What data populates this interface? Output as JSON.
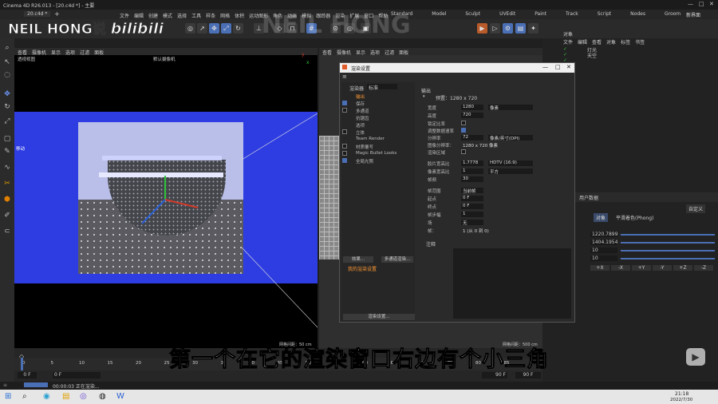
{
  "app": {
    "title": "Cinema 4D R26.013 - [20.c4d *] - 主要",
    "tab": "20.c4d *",
    "add_tab": "+"
  },
  "menu": [
    "文件",
    "编辑",
    "创建",
    "模式",
    "选择",
    "工具",
    "样条",
    "网格",
    "体积",
    "运动图形",
    "角色",
    "动画",
    "模拟",
    "跟踪器",
    "渲染",
    "扩展",
    "窗口",
    "帮助"
  ],
  "layouts": [
    "Standard",
    "Model",
    "Sculpt",
    "UVEdit",
    "Paint",
    "Track",
    "Script",
    "Nodes",
    "Groom"
  ],
  "new_layout": "新界面",
  "watermark": "NEIL HONG说",
  "brand_mark": "bilibili",
  "bg_watermark": "NEIL HONG",
  "viewport": {
    "menus": [
      "查看",
      "摄像机",
      "显示",
      "选项",
      "过滤",
      "面板"
    ],
    "name": "透视视图",
    "camera": "默认摄像机",
    "grid_left": "网格间距：50 cm",
    "grid_right": "网格间距：500 cm",
    "move_label": "移动"
  },
  "viewport2": {
    "menus": [
      "查看",
      "摄像机",
      "显示",
      "选项",
      "过滤",
      "面板"
    ]
  },
  "objects": {
    "menus": [
      "文件",
      "编辑",
      "查看",
      "对象",
      "标签",
      "书签"
    ],
    "items": [
      "灯光",
      "天空",
      "",
      "",
      "",
      ""
    ],
    "header": "对象"
  },
  "attributes": {
    "header": "属性",
    "mode": "模式",
    "edit": "编辑",
    "user": "用户数据",
    "tab_obj": "对象",
    "phong": "平滑着色(Phong)",
    "custom": "自定义",
    "fields": [
      {
        "value": "1220.7899"
      },
      {
        "value": "1404.1954"
      },
      {
        "value": "10"
      },
      {
        "value": "10"
      }
    ],
    "axes": [
      "+X",
      "-X",
      "+Y",
      "-Y",
      "+Z",
      "-Z"
    ]
  },
  "dialog": {
    "title": "渲染设置",
    "controls": [
      "—",
      "□",
      "✕"
    ],
    "renderer_label": "渲染器",
    "renderer_value": "标准",
    "nav": [
      {
        "label": "输出",
        "checked": null,
        "selected": true
      },
      {
        "label": "保存",
        "checked": true,
        "selected": false
      },
      {
        "label": "多通道",
        "checked": false,
        "selected": false
      },
      {
        "label": "抗锯齿",
        "checked": null,
        "selected": false
      },
      {
        "label": "选项",
        "checked": null,
        "selected": false
      },
      {
        "label": "立体",
        "checked": false,
        "selected": false
      },
      {
        "label": "Team Render",
        "checked": null,
        "selected": false
      },
      {
        "label": "材质覆写",
        "checked": false,
        "selected": false
      },
      {
        "label": "Magic Bullet Looks",
        "checked": false,
        "selected": false
      },
      {
        "label": "全局光照",
        "checked": true,
        "selected": false
      }
    ],
    "effect_btn": "效果...",
    "multi_btn": "多通道渲染...",
    "my_settings": "我的渲染设置",
    "settings_btn": "渲染设置...",
    "section": "输出",
    "preset": "预置：1280 x 720",
    "rows": [
      {
        "label": "宽度",
        "value": "1280",
        "drop": "像素"
      },
      {
        "label": "高度",
        "value": "720",
        "drop": ""
      },
      {
        "label": "锁定比率",
        "value": "",
        "drop": ""
      },
      {
        "label": "调整数据速率",
        "value": "",
        "drop": ""
      },
      {
        "label": "分辨率",
        "value": "72",
        "drop": "像素/英寸(DPI)"
      },
      {
        "label": "图像分辨率：",
        "value": "1280 x 720 像素",
        "drop": ""
      },
      {
        "label": "渲染区域",
        "value": "",
        "drop": ""
      },
      {
        "label": "胶片宽高比",
        "value": "1.7778",
        "drop": "HDTV (16:9)"
      },
      {
        "label": "像素宽高比",
        "value": "1",
        "drop": "平方"
      },
      {
        "label": "帧频",
        "value": "30",
        "drop": ""
      },
      {
        "label": "帧范围",
        "value": "当前帧",
        "drop": ""
      },
      {
        "label": "起点",
        "value": "0 F",
        "drop": ""
      },
      {
        "label": "终点",
        "value": "0 F",
        "drop": ""
      },
      {
        "label": "帧步幅",
        "value": "1",
        "drop": ""
      },
      {
        "label": "场",
        "value": "无",
        "drop": ""
      },
      {
        "label": "帧：",
        "value": "1 (从 0 到 0)",
        "drop": ""
      }
    ],
    "notes_label": "注释"
  },
  "timeline": {
    "ticks": [
      "0",
      "5",
      "10",
      "15",
      "20",
      "25",
      "30",
      "35",
      "40",
      "45",
      "50",
      "55",
      "60",
      "65",
      "70",
      "75",
      "80",
      "85",
      "90"
    ],
    "start": "0 F",
    "cur": "0 F",
    "end": "90 F",
    "end2": "90 F"
  },
  "status": {
    "text": "00:00:03 正在渲染..."
  },
  "taskbar": {
    "time": "21:18",
    "date": "2022/7/30"
  },
  "subtitle": "第一个在它的渲染窗口右边有个小三角",
  "colors": {
    "accent": "#4a6fb5",
    "selected": "#ff9933",
    "viewport_bg": "#2e3de2"
  }
}
